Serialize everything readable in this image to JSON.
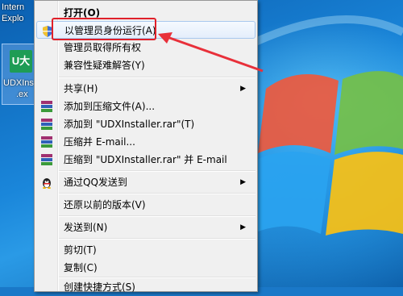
{
  "desktop": {
    "ie_label_line1": "Intern",
    "ie_label_line2": "Explo",
    "udx_icon_text": "U大",
    "udx_label_line1": "UDXIns",
    "udx_label_line2": ".ex"
  },
  "menu": {
    "open": "打开(O)",
    "run_as_admin": "以管理员身份运行(A)",
    "take_ownership": "管理员取得所有权",
    "compat_troubleshoot": "兼容性疑难解答(Y)",
    "share": "共享(H)",
    "add_to_archive": "添加到压缩文件(A)...",
    "add_to_rar": "添加到 \"UDXInstaller.rar\"(T)",
    "compress_email": "压缩并 E-mail...",
    "compress_rar_email": "压缩到 \"UDXInstaller.rar\" 并 E-mail",
    "send_via_qq": "通过QQ发送到",
    "restore_previous": "还原以前的版本(V)",
    "send_to": "发送到(N)",
    "cut": "剪切(T)",
    "copy": "复制(C)",
    "create_shortcut": "创建快捷方式(S)"
  },
  "colors": {
    "highlight_border": "#e0202a",
    "arrow": "#e8303a"
  }
}
